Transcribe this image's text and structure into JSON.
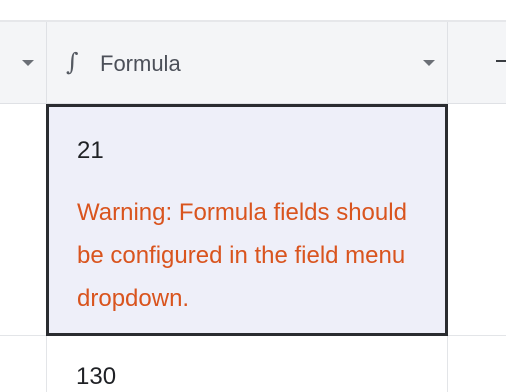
{
  "header": {
    "field_icon": "formula-icon",
    "field_icon_glyph": "∫",
    "column_label": "Formula"
  },
  "rows": [
    {
      "value": "21",
      "warning": "Warning: Formula fields should be configured in the field menu dropdown."
    },
    {
      "value": "130"
    }
  ],
  "colors": {
    "warning": "#d9541e",
    "active_cell_bg": "#eeeff9",
    "header_bg": "#f4f5f7"
  }
}
